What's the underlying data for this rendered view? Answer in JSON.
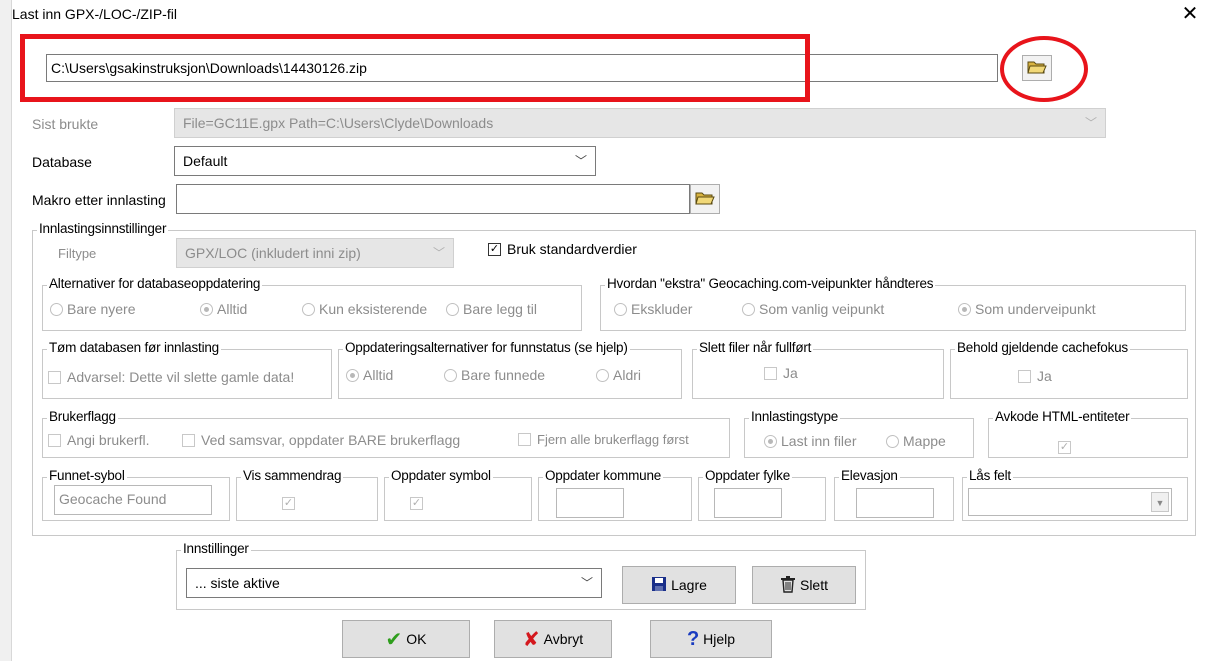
{
  "window": {
    "title": "Last inn GPX-/LOC-/ZIP-fil",
    "close_glyph": "✕"
  },
  "file_path": {
    "value": "C:\\Users\\gsakinstruksjon\\Downloads\\14430126.zip"
  },
  "recent": {
    "label": "Sist brukte",
    "value": "File=GC11E.gpx Path=C:\\Users\\Clyde\\Downloads"
  },
  "database": {
    "label": "Database",
    "value": "Default"
  },
  "macro": {
    "label": "Makro etter innlasting",
    "value": ""
  },
  "load_settings": {
    "title": "Innlastingsinnstillinger",
    "filetype_label": "Filtype",
    "filetype_value": "GPX/LOC (inkludert inni zip)",
    "use_defaults": "Bruk standardverdier"
  },
  "db_update": {
    "title": "Alternativer for databaseoppdatering",
    "options": [
      "Bare nyere",
      "Alltid",
      "Kun eksisterende",
      "Bare legg til"
    ],
    "selected": "Alltid"
  },
  "extra_waypoints": {
    "title": "Hvordan \"ekstra\" Geocaching.com-veipunkter håndteres",
    "options": [
      "Ekskluder",
      "Som vanlig veipunkt",
      "Som underveipunkt"
    ],
    "selected": "Som underveipunkt"
  },
  "empty_db": {
    "title": "Tøm databasen før innlasting",
    "checkbox": "Advarsel: Dette vil slette gamle data!"
  },
  "found_status": {
    "title": "Oppdateringsalternativer for funnstatus (se hjelp)",
    "options": [
      "Alltid",
      "Bare funnede",
      "Aldri"
    ],
    "selected": "Alltid"
  },
  "delete_files": {
    "title": "Slett filer når fullført",
    "checkbox": "Ja"
  },
  "keep_focus": {
    "title": "Behold gjeldende cachefokus",
    "checkbox": "Ja"
  },
  "user_flags": {
    "title": "Brukerflagg",
    "options": [
      "Angi brukerfl.",
      "Ved samsvar, oppdater BARE brukerflagg",
      "Fjern alle brukerflagg først"
    ]
  },
  "load_type": {
    "title": "Innlastingstype",
    "options": [
      "Last inn filer",
      "Mappe"
    ],
    "selected": "Last inn filer"
  },
  "decode_html": {
    "title": "Avkode HTML-entiteter"
  },
  "found_symbol": {
    "title": "Funnet-sybol",
    "value": "Geocache Found"
  },
  "show_summary": {
    "title": "Vis sammendrag"
  },
  "update_symbol": {
    "title": "Oppdater symbol"
  },
  "update_municipality": {
    "title": "Oppdater kommune"
  },
  "update_county": {
    "title": "Oppdater fylke"
  },
  "elevation": {
    "title": "Elevasjon"
  },
  "lock_fields": {
    "title": "Lås felt"
  },
  "settings": {
    "title": "Innstillinger",
    "value": "... siste aktive",
    "save": "Lagre",
    "delete": "Slett"
  },
  "buttons": {
    "ok": "OK",
    "cancel": "Avbryt",
    "help": "Hjelp"
  },
  "colors": {
    "annotation_red": "#e8141b",
    "disabled_gray": "#8c8c8c"
  }
}
